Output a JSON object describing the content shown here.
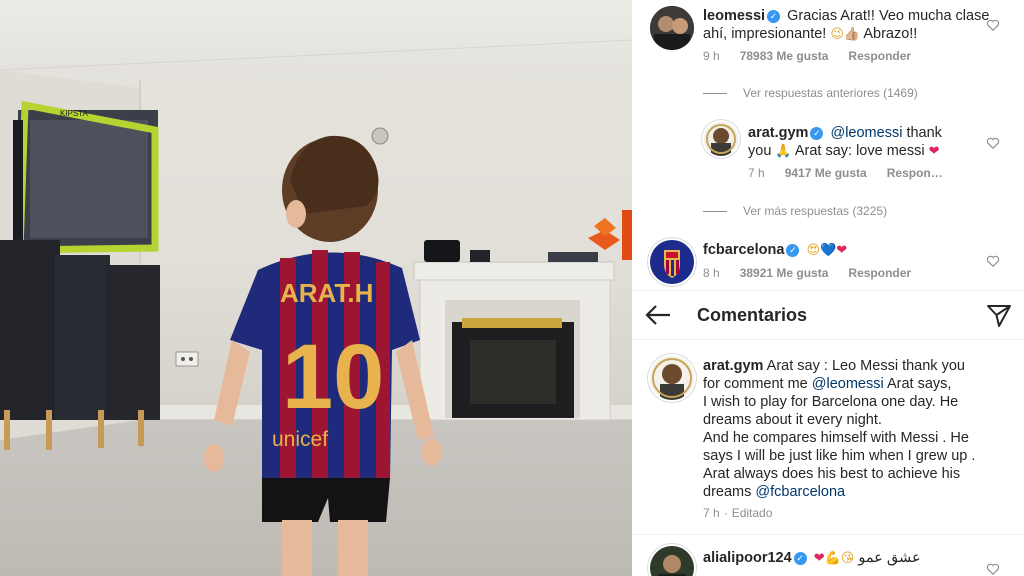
{
  "comments_header": {
    "title": "Comentarios"
  },
  "comments": [
    {
      "username": "leomessi",
      "verified": true,
      "text": " Gracias Arat!! Veo mucha clase ahí, impresionante! ",
      "emoji": "😉👍🏼",
      "text_after": " Abrazo!!",
      "time": "9 h",
      "likes": "78983 Me gusta",
      "reply_label": "Responder"
    },
    {
      "view_previous": "Ver respuestas anteriores (1469)"
    },
    {
      "username": "arat.gym",
      "verified": true,
      "mention": "@leomessi",
      "text": " thank you ",
      "emoji": "🙏",
      "text_after": " Arat say: love messi ",
      "heart": "❤",
      "time": "7 h",
      "likes": "9417 Me gusta",
      "reply_label": "Respon…"
    },
    {
      "view_more": "Ver más respuestas (3225)"
    },
    {
      "username": "fcbarcelona",
      "verified": true,
      "emoji": "😍💙❤",
      "time": "8 h",
      "likes": "38921 Me gusta",
      "reply_label": "Responder"
    }
  ],
  "post": {
    "username": "arat.gym",
    "line1": " Arat say : Leo Messi thank you",
    "line2a": "for comment me ",
    "mention1": "@leomessi",
    "line2b": " Arat says,",
    "line3": "I wish to play for Barcelona one day. He",
    "line4": "dreams about it every night.",
    "line5": "And he compares himself with Messi . He",
    "line6": "says I will be just like him when I grew up .",
    "line7": "Arat always does his best to achieve his",
    "line8a": "dreams ",
    "mention2": "@fcbarcelona",
    "time": "7 h",
    "edited": "Editado"
  },
  "bottom_comment": {
    "username": "alialipoor124",
    "verified": true,
    "emoji": "❤💪😘",
    "text": "عشق عمو"
  },
  "photo": {
    "jersey_name": "ARAT.H",
    "jersey_number": "10",
    "sponsor": "unicef",
    "goal_brand": "KIPSTA"
  },
  "colors": {
    "link": "#00376b",
    "verified": "#3897f0",
    "secondary_text": "#8e8e8e",
    "jersey_blue": "#1f2a7a",
    "jersey_red": "#9c1633",
    "jersey_gold": "#e8b24c"
  }
}
